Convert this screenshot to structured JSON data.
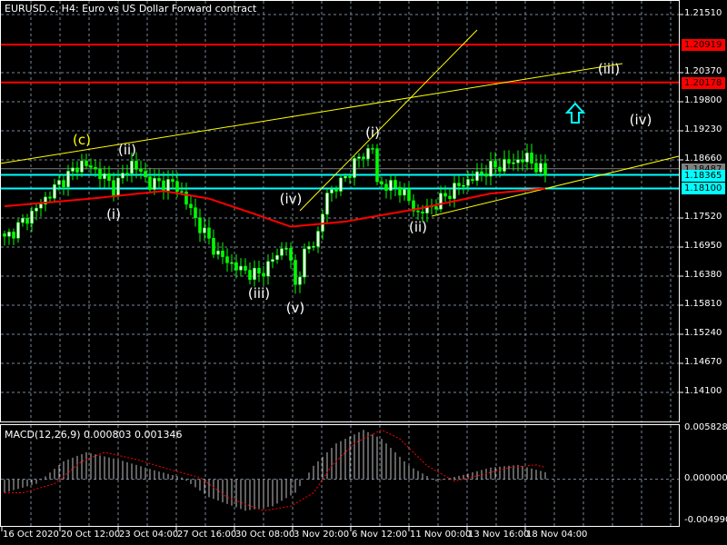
{
  "header": {
    "title": "EURUSD.c, H4:  Euro vs US Dollar Forward contract"
  },
  "macd": {
    "title": "MACD(12,26,9) 0.000803 0.001346",
    "scale": [
      "0.005828",
      "0.000000",
      "-0.004990"
    ]
  },
  "colors": {
    "up": "#00ff00",
    "down": "#ffffff",
    "ma": "#ff0000",
    "trend": "#ffff00",
    "cyan": "#00ffff",
    "hline_red": "#ff0000",
    "grid": "#778899"
  },
  "chart_data": {
    "type": "candlestick",
    "price_ticks": [
      "1.21510",
      "1.20370",
      "1.19800",
      "1.19230",
      "1.18660",
      "1.17520",
      "1.16950",
      "1.16380",
      "1.15810",
      "1.15240",
      "1.14670",
      "1.14100"
    ],
    "price_range": [
      1.141,
      1.2151
    ],
    "time_labels": [
      "16 Oct 2020",
      "20 Oct 12:00",
      "23 Oct 04:00",
      "27 Oct 16:00",
      "30 Oct 08:00",
      "3 Nov 20:00",
      "6 Nov 12:00",
      "11 Nov 00:00",
      "13 Nov 16:00",
      "18 Nov 04:00"
    ],
    "close_waypoints": [
      [
        0,
        1.171
      ],
      [
        7,
        1.177
      ],
      [
        12,
        1.182
      ],
      [
        17,
        1.186
      ],
      [
        21,
        1.184
      ],
      [
        24,
        1.181
      ],
      [
        28,
        1.186
      ],
      [
        32,
        1.182
      ],
      [
        37,
        1.182
      ],
      [
        39,
        1.18
      ],
      [
        42,
        1.175
      ],
      [
        47,
        1.168
      ],
      [
        52,
        1.165
      ],
      [
        56,
        1.164
      ],
      [
        59,
        1.167
      ],
      [
        62,
        1.17
      ],
      [
        64,
        1.162
      ],
      [
        66,
        1.168
      ],
      [
        69,
        1.172
      ],
      [
        71,
        1.18
      ],
      [
        74,
        1.182
      ],
      [
        78,
        1.187
      ],
      [
        81,
        1.189
      ],
      [
        82,
        1.182
      ],
      [
        87,
        1.181
      ],
      [
        91,
        1.176
      ],
      [
        95,
        1.178
      ],
      [
        99,
        1.181
      ],
      [
        103,
        1.183
      ],
      [
        107,
        1.185
      ],
      [
        111,
        1.186
      ],
      [
        115,
        1.187
      ],
      [
        119,
        1.1837
      ]
    ],
    "ma_waypoints": [
      [
        0,
        1.1775
      ],
      [
        19,
        1.179
      ],
      [
        35,
        1.1805
      ],
      [
        45,
        1.179
      ],
      [
        55,
        1.176
      ],
      [
        63,
        1.1735
      ],
      [
        75,
        1.1745
      ],
      [
        91,
        1.177
      ],
      [
        107,
        1.18
      ],
      [
        119,
        1.181
      ]
    ],
    "macd_range": [
      -0.00499,
      0.005828
    ],
    "macd_waypoints": [
      [
        0,
        -0.0015
      ],
      [
        7,
        -0.0005
      ],
      [
        13,
        0.002
      ],
      [
        18,
        0.003
      ],
      [
        25,
        0.0022
      ],
      [
        33,
        0.001
      ],
      [
        39,
        0.0002
      ],
      [
        45,
        -0.002
      ],
      [
        53,
        -0.0035
      ],
      [
        59,
        -0.003
      ],
      [
        64,
        -0.0015
      ],
      [
        68,
        0.0015
      ],
      [
        73,
        0.004
      ],
      [
        79,
        0.0055
      ],
      [
        83,
        0.0045
      ],
      [
        89,
        0.0015
      ],
      [
        95,
        -0.0002
      ],
      [
        101,
        0.0005
      ],
      [
        107,
        0.0013
      ],
      [
        113,
        0.0016
      ],
      [
        119,
        0.0008
      ]
    ],
    "horizontal_lines": [
      {
        "price": 1.20919,
        "label": "1.20919",
        "color": "#ff0000"
      },
      {
        "price": 1.20178,
        "label": "1.20178",
        "color": "#ff0000"
      },
      {
        "price": 1.18487,
        "label": "1.18487",
        "color": "#808080"
      },
      {
        "price": 1.18365,
        "label": "1.18365",
        "color": "#00ffff"
      },
      {
        "price": 1.181,
        "label": "1.18100",
        "color": "#00ffff"
      }
    ],
    "wave_labels": [
      {
        "text": "(c)",
        "bar": 17,
        "price": 1.1905,
        "color": "#ffff00"
      },
      {
        "text": "(ii)",
        "bar": 27,
        "price": 1.1885,
        "color": "#ffffff"
      },
      {
        "text": "(i)",
        "bar": 24,
        "price": 1.176,
        "color": "#ffffff"
      },
      {
        "text": "(iv)",
        "bar": 63,
        "price": 1.179,
        "color": "#ffffff"
      },
      {
        "text": "(iii)",
        "bar": 56,
        "price": 1.1605,
        "color": "#ffffff"
      },
      {
        "text": "(v)",
        "bar": 64,
        "price": 1.1575,
        "color": "#ffffff"
      },
      {
        "text": "(i)",
        "bar": 81,
        "price": 1.192,
        "color": "#ffffff"
      },
      {
        "text": "(ii)",
        "bar": 91,
        "price": 1.1735,
        "color": "#ffffff"
      },
      {
        "text": "(iii)",
        "bar": 133,
        "price": 1.2045,
        "color": "#ffffff"
      },
      {
        "text": "(iv)",
        "bar": 140,
        "price": 1.1945,
        "color": "#ffffff"
      }
    ]
  }
}
